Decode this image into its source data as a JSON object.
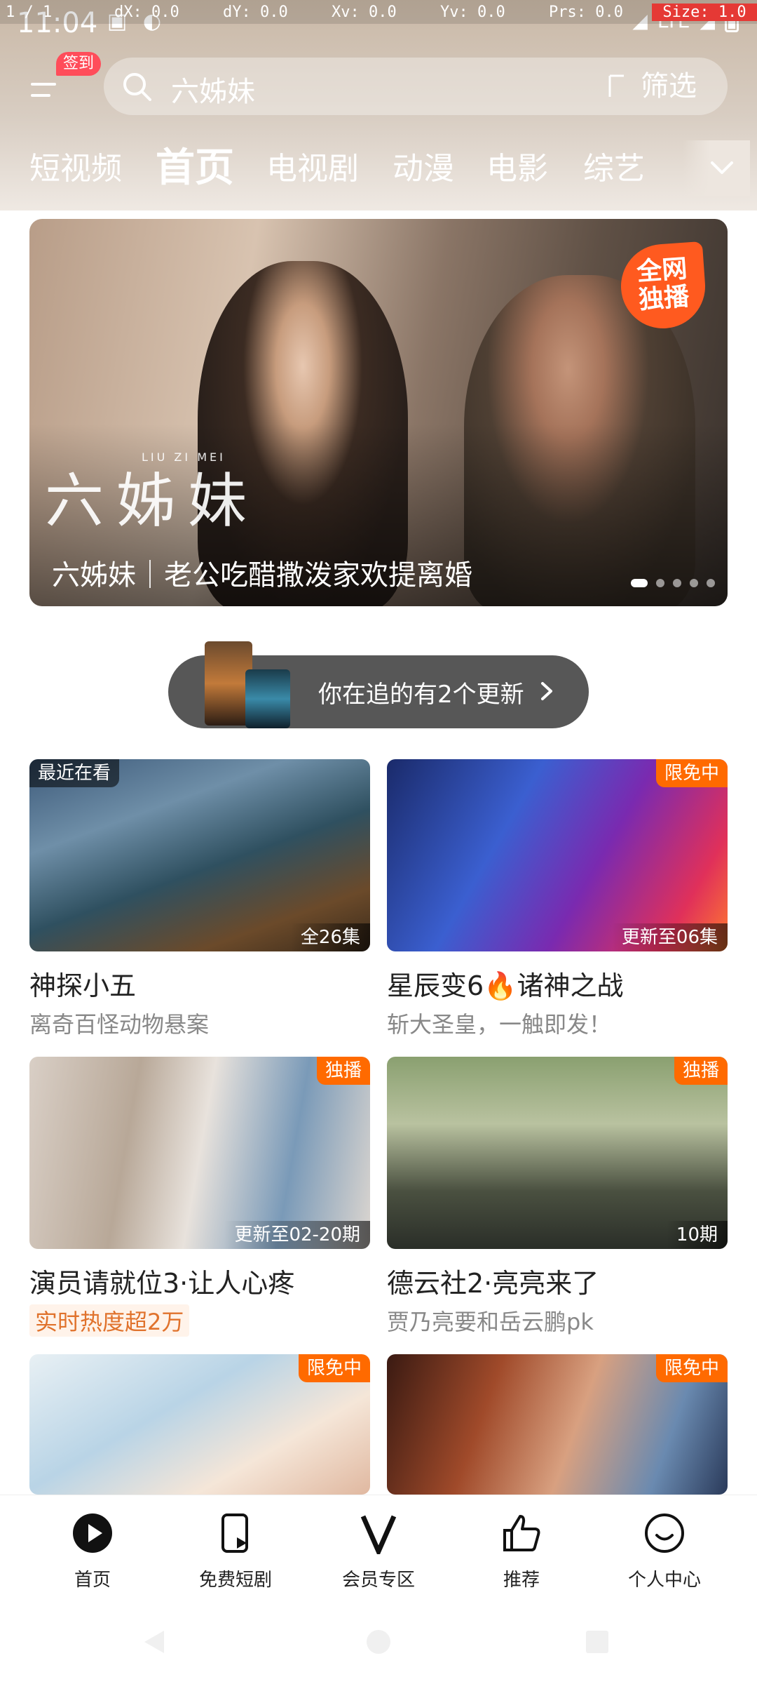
{
  "status": {
    "time": "11:04",
    "network": "LTE",
    "icons": [
      "sim-icon",
      "sync-icon",
      "wifi-icon",
      "signal-icon",
      "battery-icon"
    ]
  },
  "debug": {
    "pointer": "1 / 1",
    "dx": "dX: 0.0",
    "dy": "dY: 0.0",
    "xv": "Xv: 0.0",
    "yv": "Yv: 0.0",
    "prs": "Prs: 0.0",
    "size": "Size: 1.0"
  },
  "header": {
    "sign_badge": "签到",
    "search_placeholder": "六姊妹",
    "filter_label": "筛选"
  },
  "channels": {
    "items": [
      "短视频",
      "首页",
      "电视剧",
      "动漫",
      "电影",
      "综艺"
    ],
    "active": "首页"
  },
  "banner": {
    "logo": "六姊妹",
    "logo_pinyin": "LIU ZI MEI",
    "badge_line1": "全网",
    "badge_line2": "独播",
    "caption": "六姊妹｜老公吃醋撒泼家欢提离婚"
  },
  "follow": {
    "text": "你在追的有2个更新"
  },
  "cards": [
    {
      "tag_tl": "最近在看",
      "tag_tr": "",
      "tag_br": "全26集",
      "title": "神探小五",
      "subtitle": "离奇百怪动物悬案",
      "hot": false
    },
    {
      "tag_tl": "",
      "tag_tr": "限免中",
      "tag_br": "更新至06集",
      "title": "星辰变6🔥诸神之战",
      "subtitle": "斩大圣皇，一触即发！",
      "hot": false
    },
    {
      "tag_tl": "",
      "tag_tr": "独播",
      "tag_br": "更新至02-20期",
      "title": "演员请就位3·让人心疼",
      "subtitle": "实时热度超2万",
      "hot": true
    },
    {
      "tag_tl": "",
      "tag_tr": "独播",
      "tag_br": "10期",
      "title": "德云社2·亮亮来了",
      "subtitle": "贾乃亮要和岳云鹏pk",
      "hot": false
    },
    {
      "tag_tl": "",
      "tag_tr": "限免中",
      "tag_br": "",
      "title": "",
      "subtitle": "",
      "hot": false
    },
    {
      "tag_tl": "",
      "tag_tr": "限免中",
      "tag_br": "",
      "title": "",
      "subtitle": "",
      "hot": false
    }
  ],
  "bottom_nav": {
    "items": [
      {
        "label": "首页",
        "icon": "play-circle-icon"
      },
      {
        "label": "免费短剧",
        "icon": "phone-play-icon"
      },
      {
        "label": "会员专区",
        "icon": "vip-v-icon"
      },
      {
        "label": "推荐",
        "icon": "thumbs-up-icon"
      },
      {
        "label": "个人中心",
        "icon": "smile-icon"
      }
    ]
  },
  "colors": {
    "accent_orange": "#ff6a00",
    "hot_text": "#e0722c",
    "badge_red": "#ff4d5a"
  }
}
